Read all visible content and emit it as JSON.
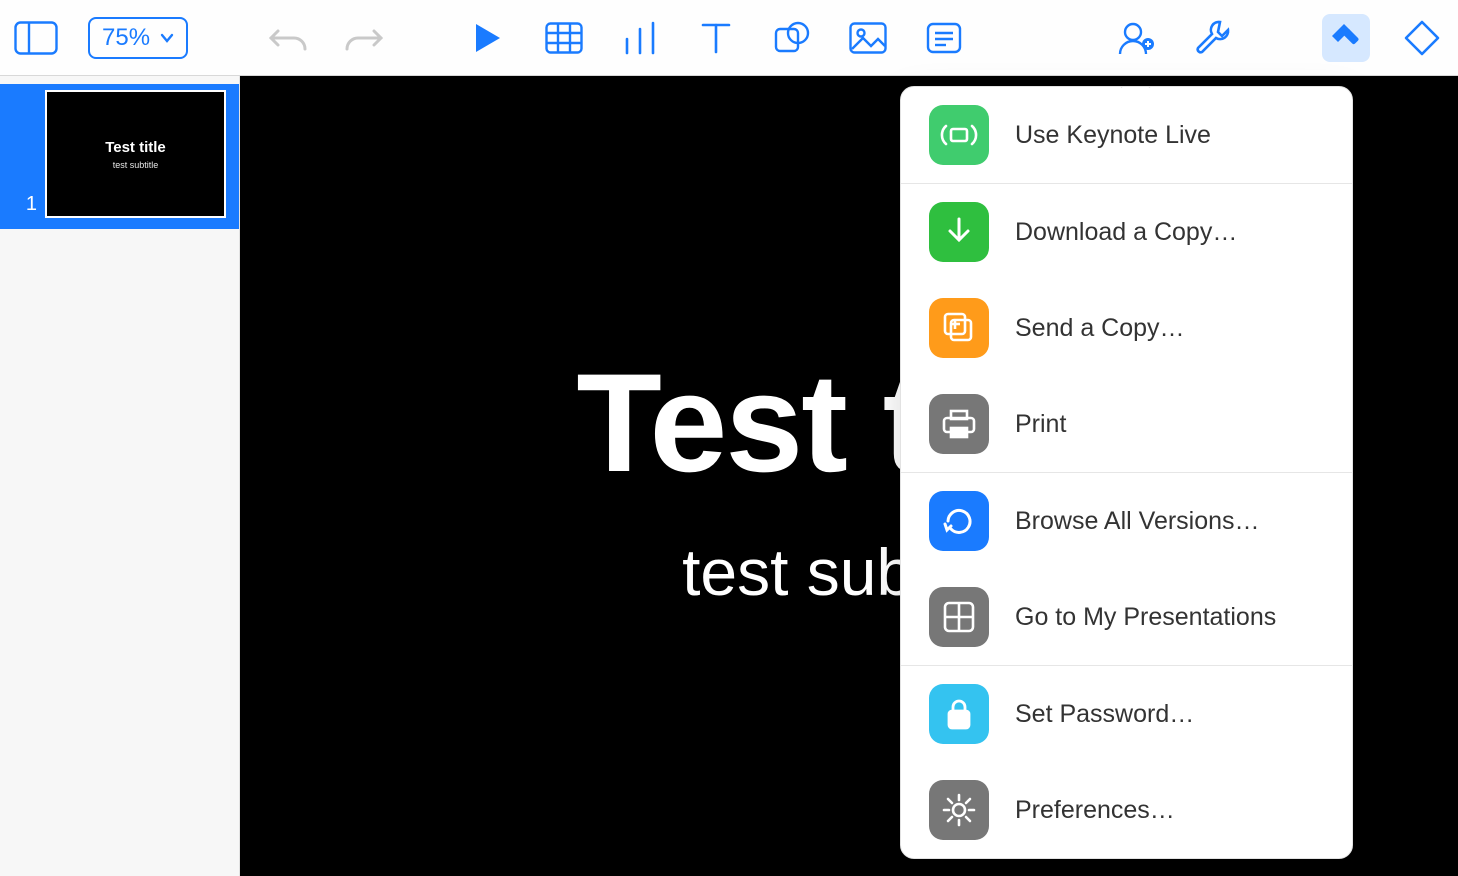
{
  "toolbar": {
    "zoom_level": "75%"
  },
  "slide": {
    "title": "Test title",
    "subtitle": "test subtitle"
  },
  "sidebar": {
    "slides": [
      {
        "number": "1",
        "title": "Test title",
        "subtitle": "test subtitle"
      }
    ]
  },
  "tools_menu": {
    "items": [
      {
        "label": "Use Keynote Live"
      },
      {
        "label": "Download a Copy…"
      },
      {
        "label": "Send a Copy…"
      },
      {
        "label": "Print"
      },
      {
        "label": "Browse All Versions…"
      },
      {
        "label": "Go to My Presentations"
      },
      {
        "label": "Set Password…"
      },
      {
        "label": "Preferences…"
      }
    ]
  }
}
